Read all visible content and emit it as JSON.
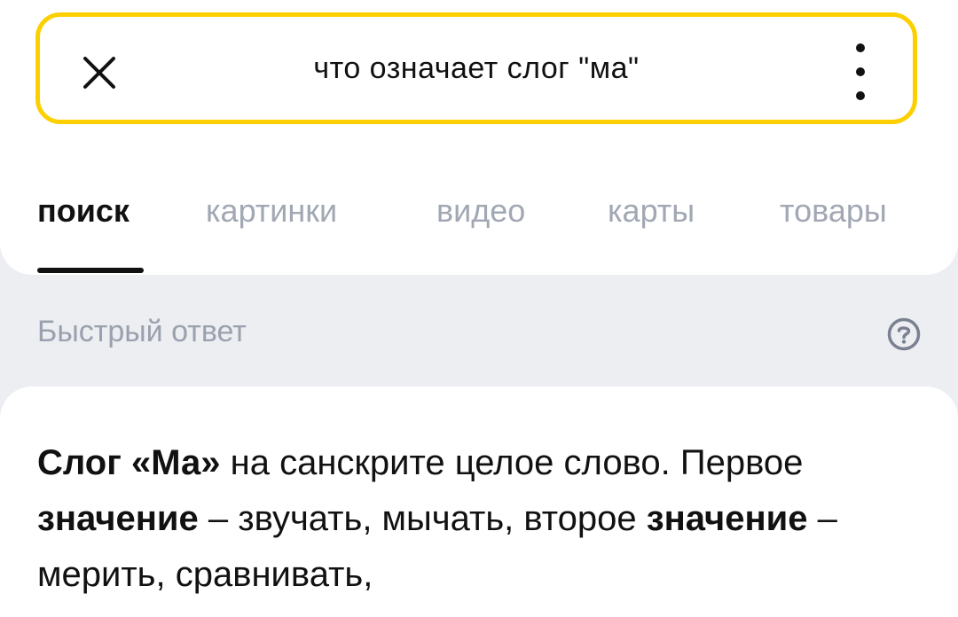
{
  "search": {
    "query": "что означает слог \"ма\""
  },
  "tabs": [
    {
      "label": "поиск",
      "active": true
    },
    {
      "label": "картинки",
      "active": false
    },
    {
      "label": "видео",
      "active": false
    },
    {
      "label": "карты",
      "active": false
    },
    {
      "label": "товары",
      "active": false
    }
  ],
  "quick_answer": {
    "header": "Быстрый ответ",
    "segments": [
      {
        "text": "Слог «Ма»",
        "bold": true
      },
      {
        "text": " на санскрите целое слово. Первое ",
        "bold": false
      },
      {
        "text": "значение",
        "bold": true
      },
      {
        "text": " – звучать, мычать, второе ",
        "bold": false
      },
      {
        "text": "значение",
        "bold": true
      },
      {
        "text": " – мерить, сравнивать,",
        "bold": false
      }
    ]
  },
  "icons": {
    "close": "close-icon",
    "more": "more-vertical-icon",
    "help": "help-circle-icon"
  },
  "colors": {
    "search_border": "#fcd000",
    "inactive_tab": "#a1a7b3",
    "page_background": "#eceef2"
  }
}
